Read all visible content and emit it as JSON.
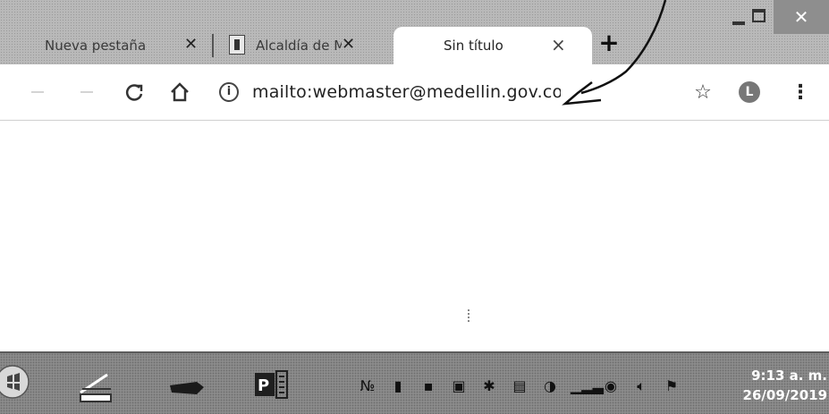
{
  "tabs": [
    {
      "title": "Nueva pestaña",
      "active": false
    },
    {
      "title": "Alcaldía de M",
      "active": false
    },
    {
      "title": "Sin título",
      "active": true
    }
  ],
  "toolbar": {
    "address": "mailto:webmaster@medellin.gov.co",
    "profile_initial": "L"
  },
  "taskbar": {
    "time": "9:13 a. m.",
    "date": "26/09/2019"
  },
  "icons": {
    "back": "arrow-left-icon",
    "forward": "arrow-right-icon",
    "reload": "reload-icon",
    "home": "home-icon",
    "info": "info-icon",
    "bookmark": "star-icon",
    "menu": "kebab-menu-icon"
  },
  "colors": {
    "tabstrip": "#b9b9b9",
    "taskbar": "#8b8b8b",
    "close_button": "#8e8e8e",
    "profile_avatar": "#777777"
  }
}
